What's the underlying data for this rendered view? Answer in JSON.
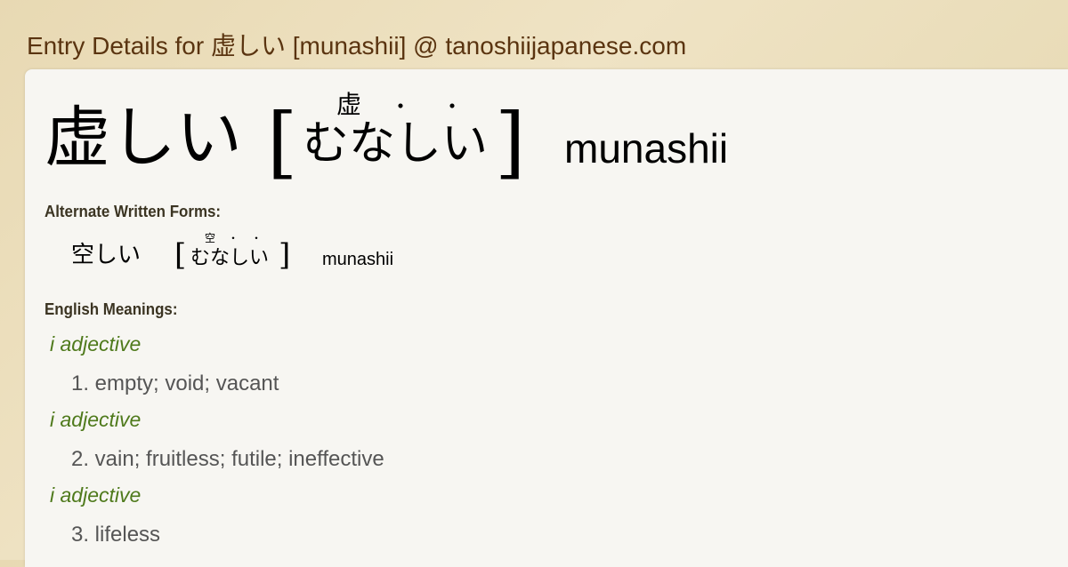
{
  "header": {
    "title": "Entry Details for 虚しい [munashii] @ tanoshiijapanese.com"
  },
  "entry": {
    "word": "虚しい",
    "bracket_open": "[",
    "bracket_close": "]",
    "reading": "むなしい",
    "furigana": "虚",
    "furigana_dot": "・",
    "romaji": "munashii"
  },
  "alternate": {
    "heading": "Alternate Written Forms:",
    "word": "空しい",
    "bracket_open": "[",
    "bracket_close": "]",
    "reading": "むなしい",
    "furigana": "空",
    "furigana_dot": "・",
    "romaji": "munashii"
  },
  "meanings": {
    "heading": "English Meanings:",
    "items": [
      {
        "pos": "i adjective",
        "text": "1. empty; void; vacant"
      },
      {
        "pos": "i adjective",
        "text": "2. vain; fruitless; futile; ineffective"
      },
      {
        "pos": "i adjective",
        "text": "3. lifeless"
      }
    ]
  }
}
